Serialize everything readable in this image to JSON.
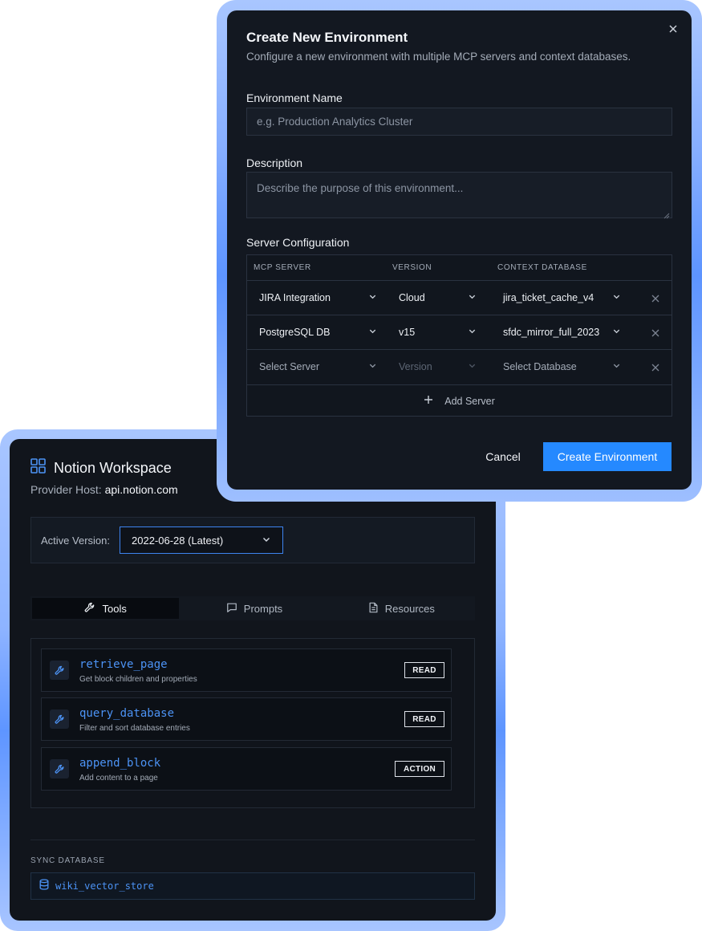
{
  "workspace": {
    "title": "Notion Workspace",
    "host_label": "Provider Host:",
    "host_value": "api.notion.com",
    "version_label": "Active Version:",
    "version_value": "2022-06-28 (Latest)",
    "tabs": [
      {
        "label": "Tools",
        "icon": "wrench-icon",
        "active": true
      },
      {
        "label": "Prompts",
        "icon": "chat-icon",
        "active": false
      },
      {
        "label": "Resources",
        "icon": "document-icon",
        "active": false
      }
    ],
    "tools": [
      {
        "name": "retrieve_page",
        "desc": "Get block children and properties",
        "badge": "READ"
      },
      {
        "name": "query_database",
        "desc": "Filter and sort database entries",
        "badge": "READ"
      },
      {
        "name": "append_block",
        "desc": "Add content to a page",
        "badge": "ACTION"
      }
    ],
    "sync_label": "SYNC DATABASE",
    "sync_value": "wiki_vector_store"
  },
  "modal": {
    "title": "Create New Environment",
    "subtitle": "Configure a new environment with multiple MCP servers and context databases.",
    "env_name_label": "Environment Name",
    "env_name_placeholder": "e.g. Production Analytics Cluster",
    "desc_label": "Description",
    "desc_placeholder": "Describe the purpose of this environment...",
    "server_config_label": "Server Configuration",
    "columns": [
      "MCP SERVER",
      "VERSION",
      "CONTEXT DATABASE"
    ],
    "rows": [
      {
        "server": "JIRA Integration",
        "version": "Cloud",
        "database": "jira_ticket_cache_v4"
      },
      {
        "server": "PostgreSQL DB",
        "version": "v15",
        "database": "sfdc_mirror_full_2023"
      },
      {
        "server": "Select Server",
        "version": "Version",
        "database": "Select Database"
      }
    ],
    "add_server_label": "Add Server",
    "cancel_label": "Cancel",
    "create_label": "Create Environment"
  },
  "colors": {
    "accent": "#2589ff",
    "link": "#4c93f5",
    "panel": "#131821",
    "glow": "#8db3ff"
  }
}
